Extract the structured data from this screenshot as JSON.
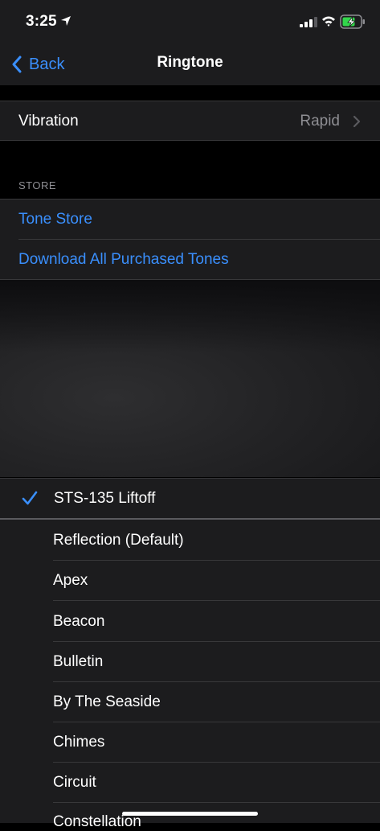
{
  "status_bar": {
    "time": "3:25"
  },
  "nav": {
    "back_label": "Back",
    "title": "Ringtone"
  },
  "vibration": {
    "label": "Vibration",
    "value": "Rapid"
  },
  "store": {
    "header": "STORE",
    "items": [
      "Tone Store",
      "Download All Purchased Tones"
    ]
  },
  "tones": {
    "selected": "STS-135 Liftoff",
    "items": [
      "Reflection (Default)",
      "Apex",
      "Beacon",
      "Bulletin",
      "By The Seaside",
      "Chimes",
      "Circuit",
      "Constellation"
    ]
  },
  "colors": {
    "accent": "#3a8ffd",
    "background": "#000000",
    "cell": "#1c1c1e",
    "secondary_text": "#8e8e93"
  }
}
